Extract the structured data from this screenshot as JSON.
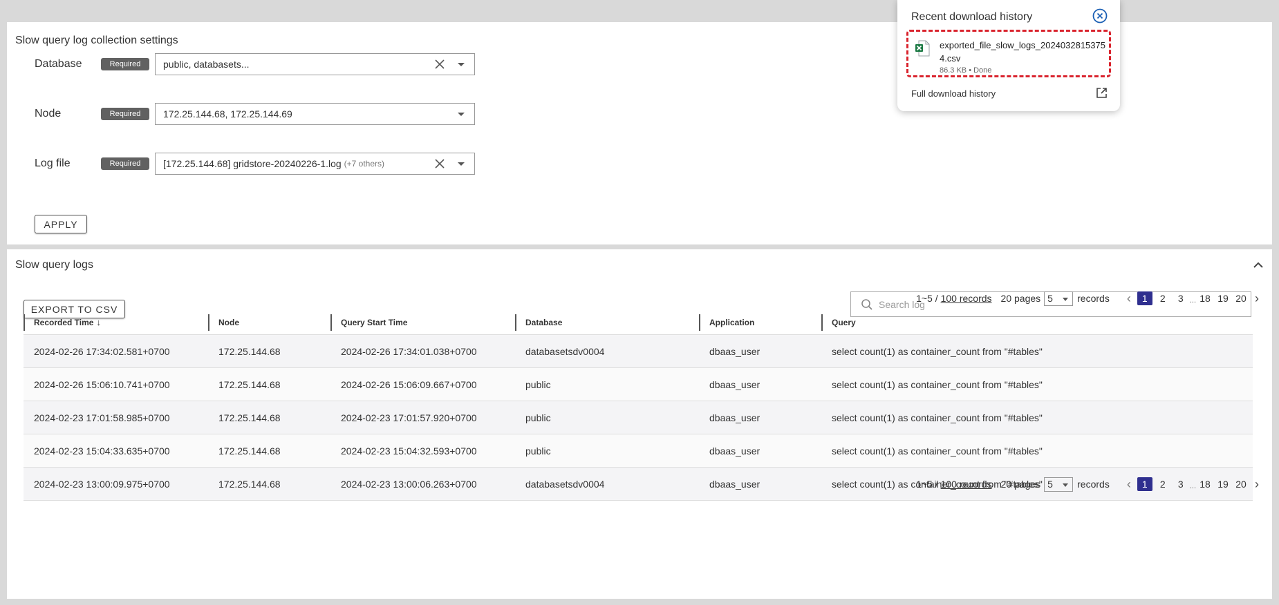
{
  "settings": {
    "title": "Slow query log collection settings",
    "required_label": "Required",
    "database": {
      "label": "Database",
      "value": "public, databasets..."
    },
    "node": {
      "label": "Node",
      "value": "172.25.144.68, 172.25.144.69"
    },
    "log_file": {
      "label": "Log file",
      "value": "[172.25.144.68] gridstore-20240226-1.log",
      "others": "(+7 others)"
    },
    "apply_label": "APPLY"
  },
  "logs": {
    "title": "Slow query logs",
    "export_label": "EXPORT TO CSV",
    "search_placeholder": "Search log",
    "pager": {
      "range": "1~5 /",
      "records_link": "100 records",
      "pages_text": "20 pages",
      "page_size": "5",
      "records_word": "records",
      "prev": "‹",
      "next": "›",
      "pages": [
        "1",
        "2",
        "3",
        "18",
        "19",
        "20"
      ],
      "ellipsis": "...",
      "active_page": "1"
    },
    "columns": [
      "Recorded Time",
      "Node",
      "Query Start Time",
      "Database",
      "Application",
      "Query"
    ],
    "sort_arrow": "↓",
    "rows": [
      [
        "2024-02-26 17:34:02.581+0700",
        "172.25.144.68",
        "2024-02-26 17:34:01.038+0700",
        "databasetsdv0004",
        "dbaas_user",
        "select count(1) as container_count from \"#tables\""
      ],
      [
        "2024-02-26 15:06:10.741+0700",
        "172.25.144.68",
        "2024-02-26 15:06:09.667+0700",
        "public",
        "dbaas_user",
        "select count(1) as container_count from \"#tables\""
      ],
      [
        "2024-02-23 17:01:58.985+0700",
        "172.25.144.68",
        "2024-02-23 17:01:57.920+0700",
        "public",
        "dbaas_user",
        "select count(1) as container_count from \"#tables\""
      ],
      [
        "2024-02-23 15:04:33.635+0700",
        "172.25.144.68",
        "2024-02-23 15:04:32.593+0700",
        "public",
        "dbaas_user",
        "select count(1) as container_count from \"#tables\""
      ],
      [
        "2024-02-23 13:00:09.975+0700",
        "172.25.144.68",
        "2024-02-23 13:00:06.263+0700",
        "databasetsdv0004",
        "dbaas_user",
        "select count(1) as container_count from \"#tables\""
      ]
    ]
  },
  "download_popup": {
    "title": "Recent download history",
    "file_name": "exported_file_slow_logs_20240328153754.csv",
    "file_status": "86.3 KB • Done",
    "full_history_label": "Full download history"
  },
  "colors": {
    "accent": "#2f2f8f",
    "highlight_border": "#d9232d",
    "close_icon": "#1a5fb4",
    "excel_green": "#1d7a45"
  },
  "icons": {
    "close": "close-circle-icon",
    "file": "excel-file-icon",
    "external": "external-link-icon",
    "search": "search-icon",
    "clear": "clear-x-icon",
    "dropdown": "caret-down-icon",
    "collapse": "chevron-up-icon"
  }
}
